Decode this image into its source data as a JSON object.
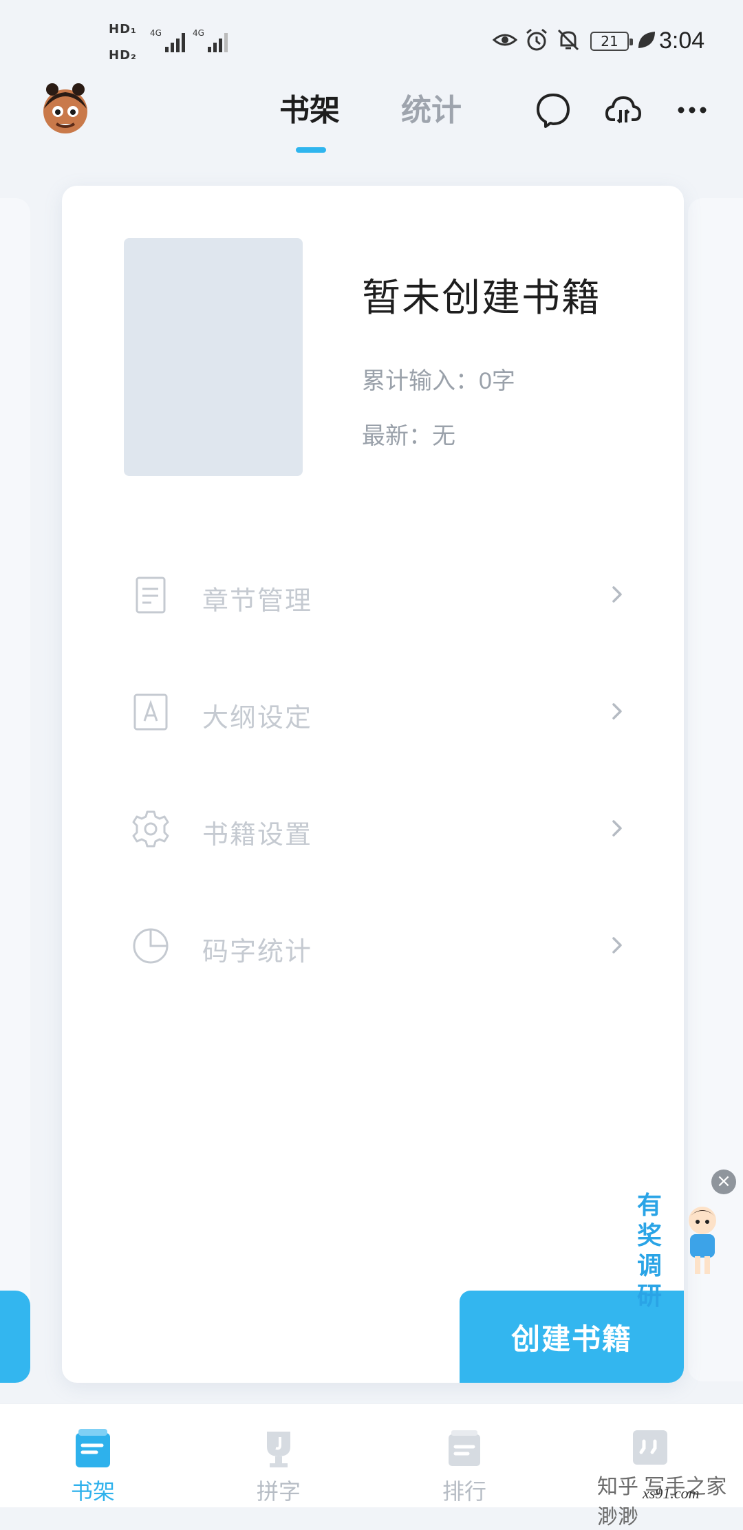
{
  "status_bar": {
    "hd1": "HD₁",
    "hd2": "HD₂",
    "network1": "4G",
    "network2": "4G",
    "battery": "21",
    "time": "3:04",
    "icons": [
      "eye-icon",
      "alarm-icon",
      "mute-icon",
      "battery-icon",
      "leaf-icon"
    ]
  },
  "header": {
    "tabs": [
      {
        "label": "书架",
        "active": true
      },
      {
        "label": "统计",
        "active": false
      }
    ],
    "actions": [
      "message-icon",
      "cloud-sync-icon",
      "more-icon"
    ],
    "accent_color": "#2fb5ee"
  },
  "book": {
    "title": "暂未创建书籍",
    "total_input": "累计输入：0字",
    "latest": "最新：无"
  },
  "menu": [
    {
      "label": "章节管理",
      "icon": "document-icon"
    },
    {
      "label": "大纲设定",
      "icon": "outline-icon"
    },
    {
      "label": "书籍设置",
      "icon": "gear-icon"
    },
    {
      "label": "码字统计",
      "icon": "pie-chart-icon"
    }
  ],
  "create_button": "创建书籍",
  "survey_badge": {
    "text": "有奖调研",
    "icon": "close-icon"
  },
  "bottom_nav": [
    {
      "label": "书架",
      "icon": "bookshelf-icon",
      "active": true
    },
    {
      "label": "拼字",
      "icon": "trophy-icon",
      "active": false
    },
    {
      "label": "排行",
      "icon": "ranking-icon",
      "active": false
    },
    {
      "label": "",
      "icon": "quote-icon",
      "active": false
    }
  ],
  "watermark": {
    "line1": "知乎 写手之家 渺渺",
    "line2": "xs91.com"
  }
}
